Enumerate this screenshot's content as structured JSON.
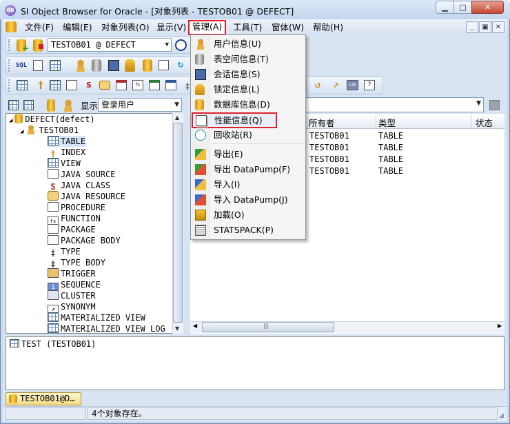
{
  "window": {
    "title": "SI Object Browser for Oracle - [对象列表 - TESTOB01 @ DEFECT]",
    "app_icon_text": "OB",
    "controls": [
      "minimize",
      "maximize",
      "close"
    ]
  },
  "menubar": {
    "items": [
      "文件(F)",
      "编辑(E)",
      "对象列表(O)",
      "显示(V)",
      "管理(A)",
      "工具(T)",
      "窗体(W)",
      "帮助(H)"
    ],
    "active": "管理(A)"
  },
  "toolbar": {
    "connection": "TESTOB01 @ DEFECT",
    "sql_label": "SQL"
  },
  "manage_menu": {
    "items": [
      {
        "label": "用户信息(U)",
        "icon": "user-icon"
      },
      {
        "label": "表空间信息(T)",
        "icon": "tablespace-icon"
      },
      {
        "label": "会话信息(S)",
        "icon": "session-icon"
      },
      {
        "label": "锁定信息(L)",
        "icon": "lock-icon"
      },
      {
        "label": "数据库信息(D)",
        "icon": "database-icon"
      },
      {
        "label": "性能信息(Q)",
        "icon": "performance-icon"
      },
      {
        "label": "回收站(R)",
        "icon": "recyclebin-icon"
      },
      {
        "label": "导出(E)",
        "icon": "export-icon"
      },
      {
        "label": "导出 DataPump(F)",
        "icon": "export-datapump-icon"
      },
      {
        "label": "导入(I)",
        "icon": "import-icon"
      },
      {
        "label": "导入 DataPump(J)",
        "icon": "import-datapump-icon"
      },
      {
        "label": "加载(O)",
        "icon": "load-icon"
      },
      {
        "label": "STATSPACK(P)",
        "icon": "statspack-icon"
      }
    ],
    "highlighted": "性能信息(Q)"
  },
  "left_panel": {
    "display_label": "显示",
    "display_value": "登录用户",
    "tree": {
      "root": "DEFECT(defect)",
      "user": "TESTOB01",
      "nodes": [
        "TABLE",
        "INDEX",
        "VIEW",
        "JAVA SOURCE",
        "JAVA CLASS",
        "JAVA RESOURCE",
        "PROCEDURE",
        "FUNCTION",
        "PACKAGE",
        "PACKAGE BODY",
        "TYPE",
        "TYPE BODY",
        "TRIGGER",
        "SEQUENCE",
        "CLUSTER",
        "SYNONYM",
        "MATERIALIZED VIEW",
        "MATERIALIZED VIEW LOG"
      ],
      "selected": "TABLE"
    }
  },
  "object_grid": {
    "columns": [
      "所有者",
      "类型",
      "状态"
    ],
    "rows": [
      {
        "owner": "TESTOB01",
        "type": "TABLE"
      },
      {
        "owner": "TESTOB01",
        "type": "TABLE"
      },
      {
        "owner": "TESTOB01",
        "type": "TABLE"
      },
      {
        "owner": "TESTOB01",
        "type": "TABLE"
      }
    ]
  },
  "sql_panel": {
    "text": "TEST (TESTOB01)"
  },
  "tabs": {
    "document": "TESTOB01@D…"
  },
  "status": {
    "message": "4个对象存在。"
  }
}
